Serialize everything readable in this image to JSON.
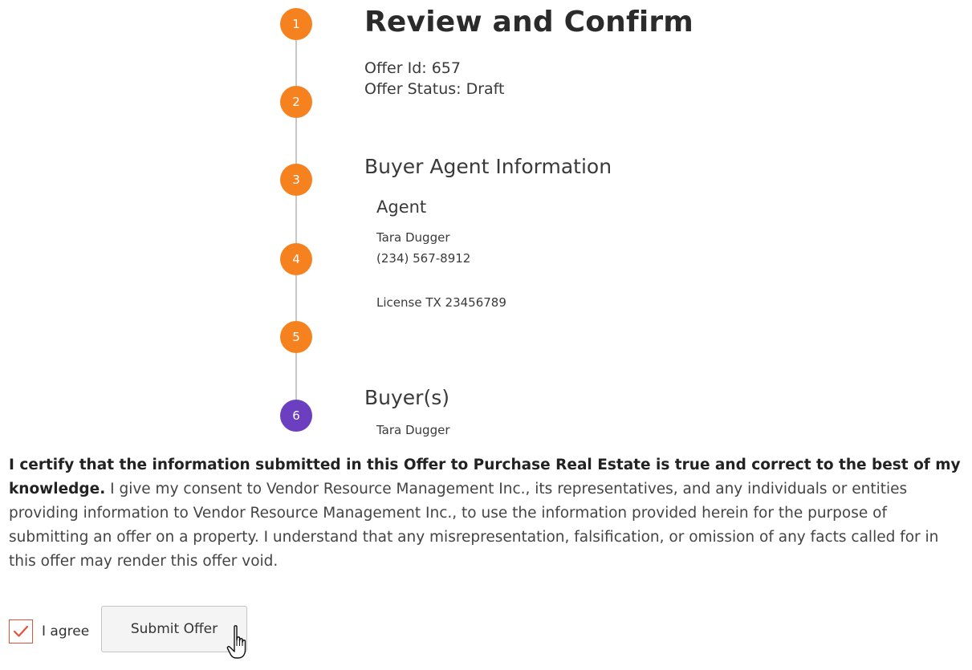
{
  "steps": [
    "1",
    "2",
    "3",
    "4",
    "5",
    "6"
  ],
  "colors": {
    "step_pending": "#f5821f",
    "step_active": "#6b3fbf",
    "checkbox_accent": "#e0533a"
  },
  "header": {
    "title": "Review and Confirm",
    "offer_id_label": "Offer Id:",
    "offer_id": "657",
    "offer_status_label": "Offer Status:",
    "offer_status": "Draft"
  },
  "buyer_agent": {
    "section_title": "Buyer Agent Information",
    "role": "Agent",
    "name": "Tara Dugger",
    "phone": "(234) 567-8912",
    "license": "License TX 23456789"
  },
  "buyers": {
    "section_title": "Buyer(s)",
    "names": [
      "Tara Dugger"
    ]
  },
  "certification": {
    "bold": "I certify that the information submitted in this Offer to Purchase Real Estate is true and correct to the best of my knowledge.",
    "text": " I give my consent to Vendor Resource Management Inc., its representatives, and any individuals or entities providing information to Vendor Resource Management Inc., to use the information provided herein for the purpose of submitting an offer on a property. I understand that any misrepresentation, falsification, or omission of any facts called for in this offer may render this offer void."
  },
  "agree": {
    "label": "I agree",
    "checked": true
  },
  "submit_label": "Submit Offer",
  "icons": {
    "checkbox_mark": "check-icon",
    "cursor": "hand-pointer-icon"
  }
}
